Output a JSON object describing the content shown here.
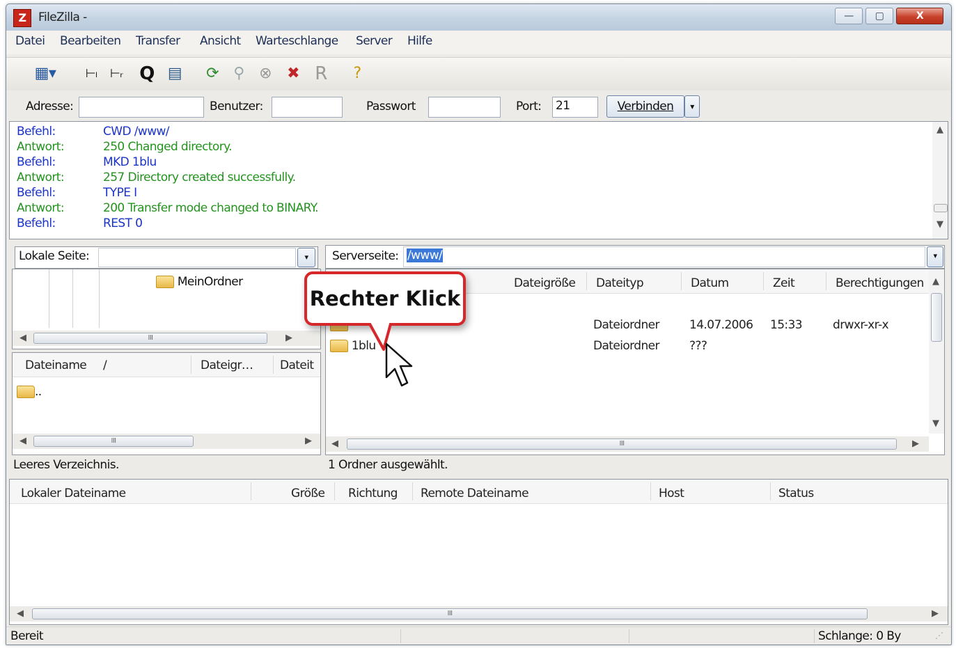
{
  "window": {
    "title": "FileZilla -",
    "buttons": {
      "minimize": "—",
      "maximize": "▢",
      "close": "X"
    }
  },
  "menu": [
    "Datei",
    "Bearbeiten",
    "Transfer",
    "Ansicht",
    "Warteschlange",
    "Server",
    "Hilfe"
  ],
  "toolbar": {
    "icons": [
      "site-manager-icon",
      "toggle-log-icon",
      "toggle-tree-icon",
      "toggle-queue-icon",
      "queue-view-icon",
      "refresh-icon",
      "filter-icon",
      "cancel-icon",
      "disconnect-icon",
      "reconnect-icon",
      "help-icon"
    ]
  },
  "connection": {
    "address_label": "Adresse:",
    "address_value": "",
    "user_label": "Benutzer:",
    "user_value": "",
    "password_label": "Passwort",
    "password_value": "",
    "port_label": "Port:",
    "port_value": "21",
    "connect_label": "Verbinden"
  },
  "log": [
    {
      "type": "Befehl:",
      "text": "CWD /www/",
      "kind": "cmd"
    },
    {
      "type": "Antwort:",
      "text": "250 Changed directory.",
      "kind": "ans"
    },
    {
      "type": "Befehl:",
      "text": "MKD 1blu",
      "kind": "cmd"
    },
    {
      "type": "Antwort:",
      "text": "257 Directory created successfully.",
      "kind": "ans"
    },
    {
      "type": "Befehl:",
      "text": "TYPE I",
      "kind": "cmd"
    },
    {
      "type": "Antwort:",
      "text": "200 Transfer mode changed to BINARY.",
      "kind": "ans"
    },
    {
      "type": "Befehl:",
      "text": "REST 0",
      "kind": "cmd"
    }
  ],
  "local": {
    "label": "Lokale Seite:",
    "path": "",
    "tree_item": "MeinOrdner",
    "columns": [
      "Dateiname",
      "/",
      "Dateigr…",
      "Dateit"
    ],
    "files": [
      {
        "name": ".."
      }
    ],
    "status": "Leeres Verzeichnis."
  },
  "remote": {
    "label": "Serverseite:",
    "path": "/www/",
    "columns": [
      "Dateigröße",
      "Dateityp",
      "Datum",
      "Zeit",
      "Berechtigungen"
    ],
    "files": [
      {
        "name": "",
        "type": "Dateiordner",
        "date": "14.07.2006",
        "time": "15:33",
        "perms": "drwxr-xr-x"
      },
      {
        "name": "1blu",
        "type": "Dateiordner",
        "date": "???",
        "time": "",
        "perms": ""
      }
    ],
    "status": "1 Ordner ausgewählt."
  },
  "callout": "Rechter Klick",
  "queue": {
    "columns": [
      "Lokaler Dateiname",
      "Größe",
      "Richtung",
      "Remote Dateiname",
      "Host",
      "Status"
    ]
  },
  "statusbar": {
    "left": "Bereit",
    "right": "Schlange: 0 By"
  },
  "scroll_grip": "III"
}
